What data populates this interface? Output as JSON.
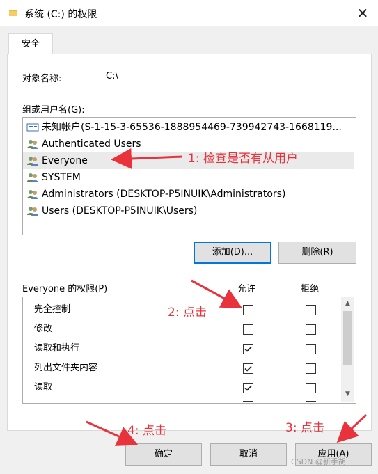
{
  "window": {
    "title": "系统 (C:) 的权限",
    "close_glyph": "✕"
  },
  "tabs": [
    {
      "label": "安全"
    }
  ],
  "object": {
    "label": "对象名称:",
    "value": "C:\\"
  },
  "groups": {
    "label": "组或用户名(G):",
    "items": [
      {
        "label": "未知帐户(S-1-15-3-65536-1888954469-739942743-1668119...",
        "icon": "unknown-account-icon"
      },
      {
        "label": "Authenticated Users",
        "icon": "users-group-icon"
      },
      {
        "label": "Everyone",
        "icon": "users-group-icon"
      },
      {
        "label": "SYSTEM",
        "icon": "users-group-icon"
      },
      {
        "label": "Administrators (DESKTOP-P5INUIK\\Administrators)",
        "icon": "users-group-icon"
      },
      {
        "label": "Users (DESKTOP-P5INUIK\\Users)",
        "icon": "users-group-icon"
      }
    ],
    "selected_index": 2
  },
  "buttons": {
    "add": "添加(D)...",
    "remove": "删除(R)"
  },
  "permissions": {
    "label": "Everyone 的权限(P)",
    "allow_header": "允许",
    "deny_header": "拒绝",
    "rows": [
      {
        "label": "完全控制",
        "allow": false,
        "deny": false
      },
      {
        "label": "修改",
        "allow": false,
        "deny": false
      },
      {
        "label": "读取和执行",
        "allow": true,
        "deny": false
      },
      {
        "label": "列出文件夹内容",
        "allow": true,
        "deny": false
      },
      {
        "label": "读取",
        "allow": true,
        "deny": false
      }
    ]
  },
  "footer": {
    "ok": "确定",
    "cancel": "取消",
    "apply": "应用(A)"
  },
  "annotations": {
    "a1": "1:  检查是否有从用户",
    "a2": "2:  点击",
    "a3": "3:  点击",
    "a4": "4:  点击",
    "color": "#e8333c"
  },
  "watermark": "CSDN @新手胡"
}
